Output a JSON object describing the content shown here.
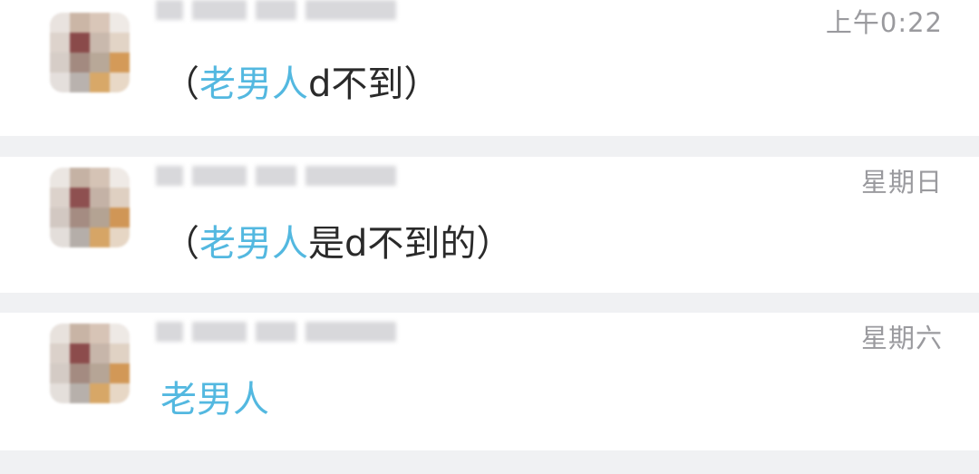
{
  "conversations": [
    {
      "time": "上午0:22",
      "paren_open": "（",
      "mention": "老男人",
      "text": "d不到",
      "paren_close": "）"
    },
    {
      "time": "星期日",
      "paren_open": "（",
      "mention": "老男人",
      "text": "是d不到的",
      "paren_close": "）"
    },
    {
      "time": "星期六",
      "mention": "老男人"
    }
  ],
  "colors": {
    "mention": "#53b8e0",
    "time": "#9a9a9e",
    "text": "#2a2a2a",
    "divider": "#f0f1f3"
  }
}
